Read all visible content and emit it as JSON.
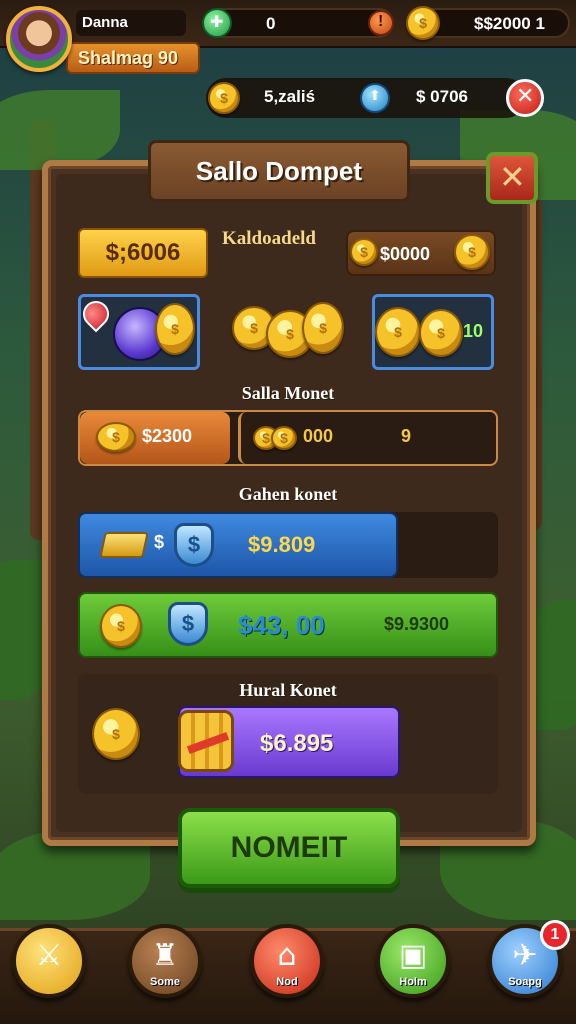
{
  "topbar": {
    "player_name": "Danna",
    "level_label": "Shalmag 90",
    "gems_value": "0",
    "coins_value": "$$2000 1"
  },
  "row2": {
    "value_left": "5,zaliś",
    "value_right": "$ 0706"
  },
  "panel": {
    "title": "Sallo Dompet",
    "gold_badge": "$;6006",
    "label_kald": "Kaldoadeld",
    "pill_right": "$0000",
    "card3_value": "10",
    "section1": "Salla Monet",
    "bar1_left": "$2300",
    "bar1_mid": "000",
    "bar1_right": "9",
    "section2": "Gahen konet",
    "blue_bar_prefix": "$",
    "blue_bar_value": "$9.809",
    "green_bar_value": "$43, 00",
    "green_bar_right": "$9.9300",
    "section3": "Hural Konet",
    "purple_bar_value": "$6.895",
    "cta_label": "NOMEIT"
  },
  "bottomnav": {
    "items": [
      {
        "label": "",
        "icon": "sword-icon",
        "color": "#f2b12a"
      },
      {
        "label": "Some",
        "icon": "trophy-icon",
        "color": "#8a5a32"
      },
      {
        "label": "Nod",
        "icon": "home-icon",
        "color": "#e0412a"
      },
      {
        "label": "Holm",
        "icon": "chest-icon",
        "color": "#4fb82a"
      },
      {
        "label": "Soapg",
        "icon": "shop-icon",
        "color": "#2f8ae0"
      }
    ],
    "notif_count": "1"
  }
}
